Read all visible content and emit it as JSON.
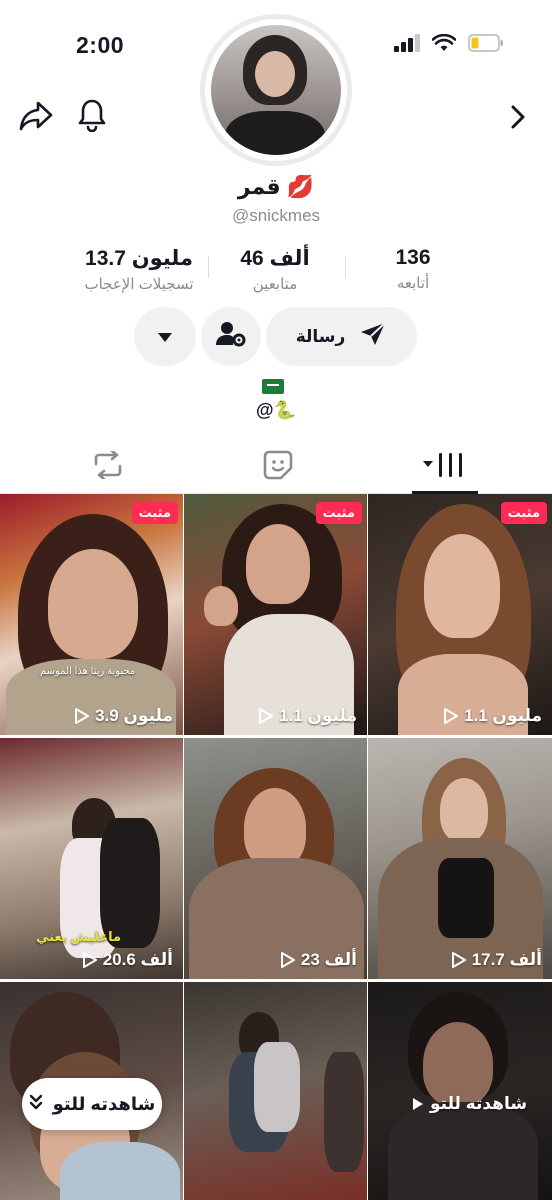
{
  "status_bar": {
    "time": "2:00"
  },
  "profile": {
    "display_name": "قمر 💋",
    "username": "@snickmes",
    "bio_line": "@🐍"
  },
  "stats": [
    {
      "value": "136",
      "label": "أتابعه"
    },
    {
      "value": "46 ألف",
      "label": "متابعين"
    },
    {
      "value": "13.7 مليون",
      "label": "تسجيلات الإعجاب"
    }
  ],
  "actions": {
    "message_label": "رسالة"
  },
  "tabs": [
    "videos",
    "liked",
    "reposts"
  ],
  "videos": [
    {
      "badge": "مثبت",
      "views": "1.1 مليون",
      "caption": "",
      "overlay": ""
    },
    {
      "badge": "مثبت",
      "views": "1.1 مليون",
      "caption": "",
      "overlay": ""
    },
    {
      "badge": "مثبت",
      "views": "3.9 مليون",
      "caption": "محبوبة ريتا هذا الموسم",
      "overlay": ""
    },
    {
      "badge": "",
      "views": "17.7 ألف",
      "caption": "",
      "overlay": ""
    },
    {
      "badge": "",
      "views": "23 ألف",
      "caption": "",
      "overlay": ""
    },
    {
      "badge": "",
      "views": "20.6 ألف",
      "caption": "ماعليش يعني",
      "overlay": ""
    },
    {
      "badge": "",
      "views": "",
      "caption": "",
      "overlay": "شاهدته للتو"
    },
    {
      "badge": "",
      "views": "",
      "caption": "",
      "overlay": ""
    },
    {
      "badge": "",
      "views": "",
      "caption": "",
      "overlay": ""
    }
  ],
  "watched_pill": {
    "label": "شاهدته للتو"
  },
  "colors": {
    "accent": "#fe2c55",
    "text": "#161823",
    "muted": "#8a8b91",
    "button_bg": "#f1f1f2"
  }
}
